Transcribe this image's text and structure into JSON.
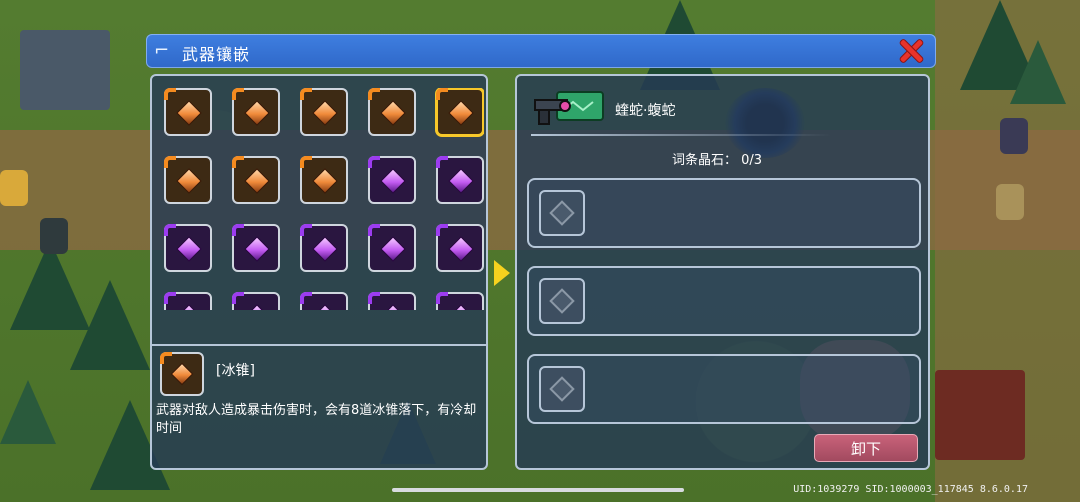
{
  "window": {
    "title": "武器镶嵌",
    "title_icon": "pistol-icon",
    "close_icon": "close-icon"
  },
  "gem_grid": {
    "gems": [
      {
        "color": "orange"
      },
      {
        "color": "orange"
      },
      {
        "color": "orange"
      },
      {
        "color": "orange"
      },
      {
        "color": "orange",
        "selected": true
      },
      {
        "color": "orange"
      },
      {
        "color": "orange"
      },
      {
        "color": "orange"
      },
      {
        "color": "purple"
      },
      {
        "color": "purple"
      },
      {
        "color": "purple"
      },
      {
        "color": "purple"
      },
      {
        "color": "purple"
      },
      {
        "color": "purple"
      },
      {
        "color": "purple"
      },
      {
        "color": "purple"
      },
      {
        "color": "purple"
      },
      {
        "color": "purple"
      },
      {
        "color": "purple"
      },
      {
        "color": "purple"
      }
    ]
  },
  "selected_gem": {
    "name": "[冰锥]",
    "description": "武器对敌人造成暴击伤害时，会有8道冰锥落下，有冷却时间"
  },
  "weapon": {
    "name": "蝰蛇·蝮蛇",
    "crystal_label": "词条晶石：",
    "crystal_count": "0/3"
  },
  "slots": [
    {
      "state": "empty"
    },
    {
      "state": "empty"
    },
    {
      "state": "empty"
    }
  ],
  "actions": {
    "unload_label": "卸下"
  },
  "footer": {
    "version": "UID:1039279 SID:1000003_117845 8.6.0.17"
  },
  "colors": {
    "title_bar": "#3f7fe0",
    "orange_gem": "#f08a3a",
    "purple_gem": "#c45cf2",
    "unload_button": "#b5546b",
    "arrow": "#f7d21e"
  }
}
